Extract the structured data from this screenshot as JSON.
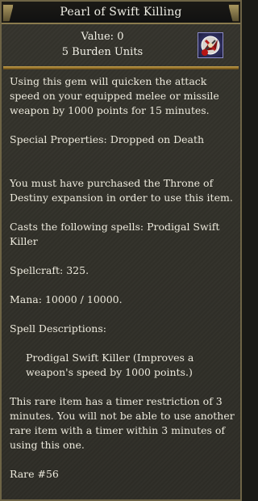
{
  "window": {
    "title": "Pearl of Swift Killing"
  },
  "header": {
    "value": "Value: 0",
    "burden": "5 Burden Units",
    "icon": "pearl-gem-icon"
  },
  "description": {
    "use_text": "Using this gem will quicken the attack speed on your equipped melee or missile weapon by 1000 points for 15 minutes.",
    "special_properties": "Special Properties: Dropped on Death",
    "requirement": "You must have purchased the Throne of Destiny expansion in order to use this item.",
    "casts": "Casts the following spells: Prodigal Swift Killer",
    "spellcraft": "Spellcraft: 325.",
    "mana": "Mana: 10000 / 10000.",
    "spell_desc_heading": "Spell Descriptions:",
    "spell_desc": "Prodigal Swift Killer (Improves a weapon's speed by 1000 points.)",
    "timer_note": "This rare item has a timer restriction of 3 minutes. You will not be able to use another rare item with a timer within 3 minutes of using this one.",
    "rare_number": "Rare #56"
  },
  "colors": {
    "text": "#ece9dc",
    "divider": "#c9a552",
    "background": "#33322b"
  }
}
